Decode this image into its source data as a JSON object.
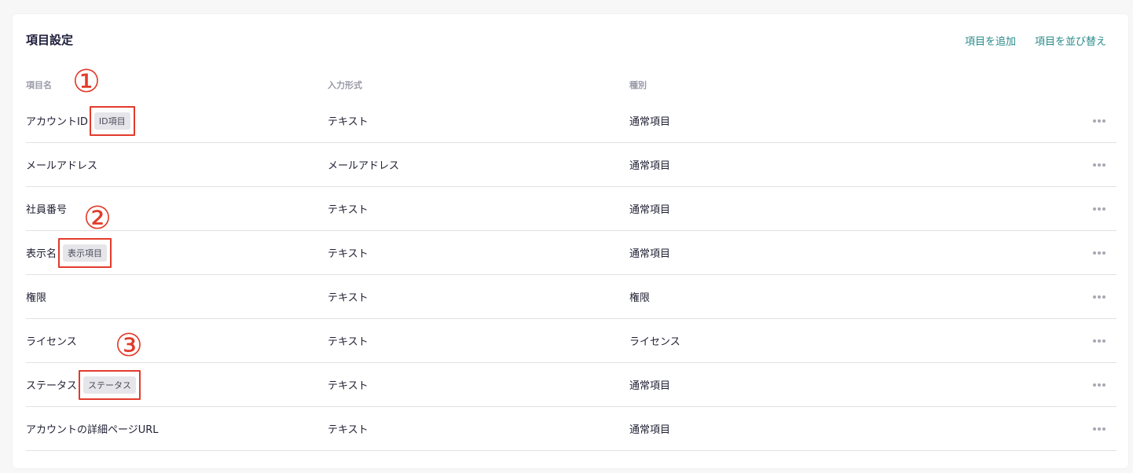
{
  "title": "項目設定",
  "actions": {
    "add": "項目を追加",
    "sort": "項目を並び替え"
  },
  "columns": {
    "name": "項目名",
    "input_type": "入力形式",
    "kind": "種別"
  },
  "rows": [
    {
      "name": "アカウントID",
      "badge": "ID項目",
      "input_type": "テキスト",
      "kind": "通常項目"
    },
    {
      "name": "メールアドレス",
      "badge": "",
      "input_type": "メールアドレス",
      "kind": "通常項目"
    },
    {
      "name": "社員番号",
      "badge": "",
      "input_type": "テキスト",
      "kind": "通常項目"
    },
    {
      "name": "表示名",
      "badge": "表示項目",
      "input_type": "テキスト",
      "kind": "通常項目"
    },
    {
      "name": "権限",
      "badge": "",
      "input_type": "テキスト",
      "kind": "権限"
    },
    {
      "name": "ライセンス",
      "badge": "",
      "input_type": "テキスト",
      "kind": "ライセンス"
    },
    {
      "name": "ステータス",
      "badge": "ステータス",
      "input_type": "テキスト",
      "kind": "通常項目"
    },
    {
      "name": "アカウントの詳細ページURL",
      "badge": "",
      "input_type": "テキスト",
      "kind": "通常項目"
    }
  ],
  "markers": [
    "①",
    "②",
    "③"
  ],
  "colors": {
    "accent": "#2a8a8a",
    "highlight": "#e23b2a"
  }
}
